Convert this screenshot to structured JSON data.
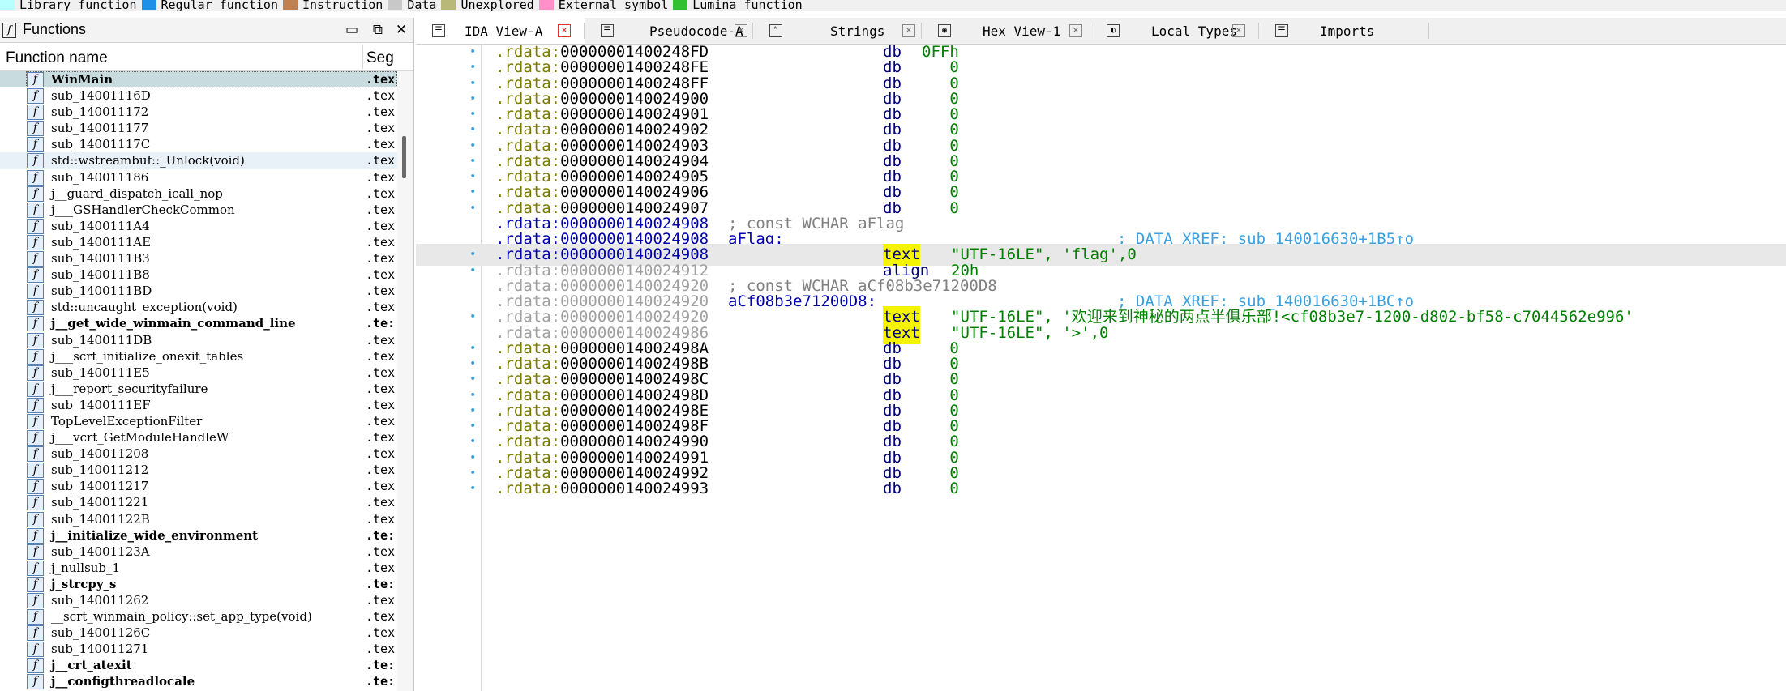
{
  "legend": [
    {
      "label": "Library function",
      "color": "#b8ffff"
    },
    {
      "label": "Regular function",
      "color": "#1e90e8"
    },
    {
      "label": "Instruction",
      "color": "#c08050"
    },
    {
      "label": "Data",
      "color": "#c8c8c8"
    },
    {
      "label": "Unexplored",
      "color": "#b8b878"
    },
    {
      "label": "External symbol",
      "color": "#ff90c8"
    },
    {
      "label": "Lumina function",
      "color": "#30c030"
    }
  ],
  "functions_panel": {
    "title": "Functions",
    "col_name": "Function name",
    "col_seg": "Seg",
    "btn_max": "▭",
    "btn_restore": "⧉",
    "btn_close": "✕",
    "items": [
      {
        "name": "WinMain",
        "seg": ".tex",
        "bold": true,
        "state": "sel"
      },
      {
        "name": "sub_14001116D",
        "seg": ".tex",
        "bold": false
      },
      {
        "name": "sub_140011172",
        "seg": ".tex",
        "bold": false
      },
      {
        "name": "sub_140011177",
        "seg": ".tex",
        "bold": false
      },
      {
        "name": "sub_14001117C",
        "seg": ".tex",
        "bold": false
      },
      {
        "name": "std::wstreambuf::_Unlock(void)",
        "seg": ".tex",
        "bold": false,
        "state": "hl"
      },
      {
        "name": "sub_140011186",
        "seg": ".tex",
        "bold": false
      },
      {
        "name": "j__guard_dispatch_icall_nop",
        "seg": ".tex",
        "bold": false
      },
      {
        "name": "j___GSHandlerCheckCommon",
        "seg": ".tex",
        "bold": false
      },
      {
        "name": "sub_1400111A4",
        "seg": ".tex",
        "bold": false
      },
      {
        "name": "sub_1400111AE",
        "seg": ".tex",
        "bold": false
      },
      {
        "name": "sub_1400111B3",
        "seg": ".tex",
        "bold": false
      },
      {
        "name": "sub_1400111B8",
        "seg": ".tex",
        "bold": false
      },
      {
        "name": "sub_1400111BD",
        "seg": ".tex",
        "bold": false
      },
      {
        "name": "std::uncaught_exception(void)",
        "seg": ".tex",
        "bold": false
      },
      {
        "name": "j__get_wide_winmain_command_line",
        "seg": ".te:",
        "bold": true
      },
      {
        "name": "sub_1400111DB",
        "seg": ".tex",
        "bold": false
      },
      {
        "name": "j___scrt_initialize_onexit_tables",
        "seg": ".tex",
        "bold": false
      },
      {
        "name": "sub_1400111E5",
        "seg": ".tex",
        "bold": false
      },
      {
        "name": "j___report_securityfailure",
        "seg": ".tex",
        "bold": false
      },
      {
        "name": "sub_1400111EF",
        "seg": ".tex",
        "bold": false
      },
      {
        "name": "TopLevelExceptionFilter",
        "seg": ".tex",
        "bold": false
      },
      {
        "name": "j___vcrt_GetModuleHandleW",
        "seg": ".tex",
        "bold": false
      },
      {
        "name": "sub_140011208",
        "seg": ".tex",
        "bold": false
      },
      {
        "name": "sub_140011212",
        "seg": ".tex",
        "bold": false
      },
      {
        "name": "sub_140011217",
        "seg": ".tex",
        "bold": false
      },
      {
        "name": "sub_140011221",
        "seg": ".tex",
        "bold": false
      },
      {
        "name": "sub_14001122B",
        "seg": ".tex",
        "bold": false
      },
      {
        "name": "j__initialize_wide_environment",
        "seg": ".te:",
        "bold": true
      },
      {
        "name": "sub_14001123A",
        "seg": ".tex",
        "bold": false
      },
      {
        "name": "j_nullsub_1",
        "seg": ".tex",
        "bold": false
      },
      {
        "name": "j_strcpy_s",
        "seg": ".te:",
        "bold": true
      },
      {
        "name": "sub_140011262",
        "seg": ".tex",
        "bold": false
      },
      {
        "name": "__scrt_winmain_policy::set_app_type(void)",
        "seg": ".tex",
        "bold": false
      },
      {
        "name": "sub_14001126C",
        "seg": ".tex",
        "bold": false
      },
      {
        "name": "sub_140011271",
        "seg": ".tex",
        "bold": false
      },
      {
        "name": "j__crt_atexit",
        "seg": ".te:",
        "bold": true
      },
      {
        "name": "j__configthreadlocale",
        "seg": ".te:",
        "bold": true
      }
    ]
  },
  "tabs": [
    {
      "label": "IDA View-A",
      "icon": "ida-view-icon",
      "active": true
    },
    {
      "label": "Pseudocode-A",
      "icon": "pseudocode-icon",
      "active": false
    },
    {
      "label": "Strings",
      "icon": "strings-icon",
      "active": false
    },
    {
      "label": "Hex View-1",
      "icon": "hex-view-icon",
      "active": false
    },
    {
      "label": "Local Types",
      "icon": "local-types-icon",
      "active": false
    },
    {
      "label": "Imports",
      "icon": "imports-icon",
      "active": false
    }
  ],
  "disasm": [
    {
      "dot": true,
      "seg": ".rdata:",
      "off": "00000001400248FD",
      "ins": "db",
      "opr": "0FFh"
    },
    {
      "dot": true,
      "seg": ".rdata:",
      "off": "00000001400248FE",
      "ins": "db",
      "opr": "   0"
    },
    {
      "dot": true,
      "seg": ".rdata:",
      "off": "00000001400248FF",
      "ins": "db",
      "opr": "   0"
    },
    {
      "dot": true,
      "seg": ".rdata:",
      "off": "0000000140024900",
      "ins": "db",
      "opr": "   0"
    },
    {
      "dot": true,
      "seg": ".rdata:",
      "off": "0000000140024901",
      "ins": "db",
      "opr": "   0"
    },
    {
      "dot": true,
      "seg": ".rdata:",
      "off": "0000000140024902",
      "ins": "db",
      "opr": "   0"
    },
    {
      "dot": true,
      "seg": ".rdata:",
      "off": "0000000140024903",
      "ins": "db",
      "opr": "   0"
    },
    {
      "dot": true,
      "seg": ".rdata:",
      "off": "0000000140024904",
      "ins": "db",
      "opr": "   0"
    },
    {
      "dot": true,
      "seg": ".rdata:",
      "off": "0000000140024905",
      "ins": "db",
      "opr": "   0"
    },
    {
      "dot": true,
      "seg": ".rdata:",
      "off": "0000000140024906",
      "ins": "db",
      "opr": "   0"
    },
    {
      "dot": true,
      "seg": ".rdata:",
      "off": "0000000140024907",
      "ins": "db",
      "opr": "   0"
    },
    {
      "dot": false,
      "seg": ".rdata:",
      "off": "0000000140024908",
      "blue": true,
      "cmt": "; const WCHAR aFlag"
    },
    {
      "dot": false,
      "seg": ".rdata:",
      "off": "0000000140024908",
      "blue": true,
      "lbl": "aFlag:",
      "xref": "; DATA XREF: sub_140016630+1B5↑o"
    },
    {
      "dot": true,
      "seg": ".rdata:",
      "off": "0000000140024908",
      "blue": true,
      "cur": true,
      "ins": "text",
      "ins_hl": true,
      "str": "\"UTF-16LE\", 'flag',0"
    },
    {
      "dot": true,
      "seg": ".rdata:",
      "off": "0000000140024912",
      "ro": true,
      "ins": "align",
      "opr": "20h"
    },
    {
      "dot": false,
      "seg": ".rdata:",
      "off": "0000000140024920",
      "ro": true,
      "cmt": "; const WCHAR aCf08b3e71200D8"
    },
    {
      "dot": false,
      "seg": ".rdata:",
      "off": "0000000140024920",
      "ro": true,
      "lbl": "aCf08b3e71200D8:",
      "xref": "; DATA XREF: sub_140016630+1BC↑o"
    },
    {
      "dot": true,
      "seg": ".rdata:",
      "off": "0000000140024920",
      "ro": true,
      "ins": "text",
      "ins_hl": true,
      "str": "\"UTF-16LE\", '欢迎来到神秘的两点半俱乐部!<cf08b3e7-1200-d802-bf58-c7044562e996'"
    },
    {
      "dot": false,
      "seg": ".rdata:",
      "off": "0000000140024986",
      "ro": true,
      "ins": "text",
      "ins_hl": true,
      "str": "\"UTF-16LE\", '>',0"
    },
    {
      "dot": true,
      "seg": ".rdata:",
      "off": "000000014002498A",
      "ins": "db",
      "opr": "   0"
    },
    {
      "dot": true,
      "seg": ".rdata:",
      "off": "000000014002498B",
      "ins": "db",
      "opr": "   0"
    },
    {
      "dot": true,
      "seg": ".rdata:",
      "off": "000000014002498C",
      "ins": "db",
      "opr": "   0"
    },
    {
      "dot": true,
      "seg": ".rdata:",
      "off": "000000014002498D",
      "ins": "db",
      "opr": "   0"
    },
    {
      "dot": true,
      "seg": ".rdata:",
      "off": "000000014002498E",
      "ins": "db",
      "opr": "   0"
    },
    {
      "dot": true,
      "seg": ".rdata:",
      "off": "000000014002498F",
      "ins": "db",
      "opr": "   0"
    },
    {
      "dot": true,
      "seg": ".rdata:",
      "off": "0000000140024990",
      "ins": "db",
      "opr": "   0"
    },
    {
      "dot": true,
      "seg": ".rdata:",
      "off": "0000000140024991",
      "ins": "db",
      "opr": "   0"
    },
    {
      "dot": true,
      "seg": ".rdata:",
      "off": "0000000140024992",
      "ins": "db",
      "opr": "   0"
    },
    {
      "dot": true,
      "seg": ".rdata:",
      "off": "0000000140024993",
      "ins": "db",
      "opr": "   0"
    }
  ]
}
